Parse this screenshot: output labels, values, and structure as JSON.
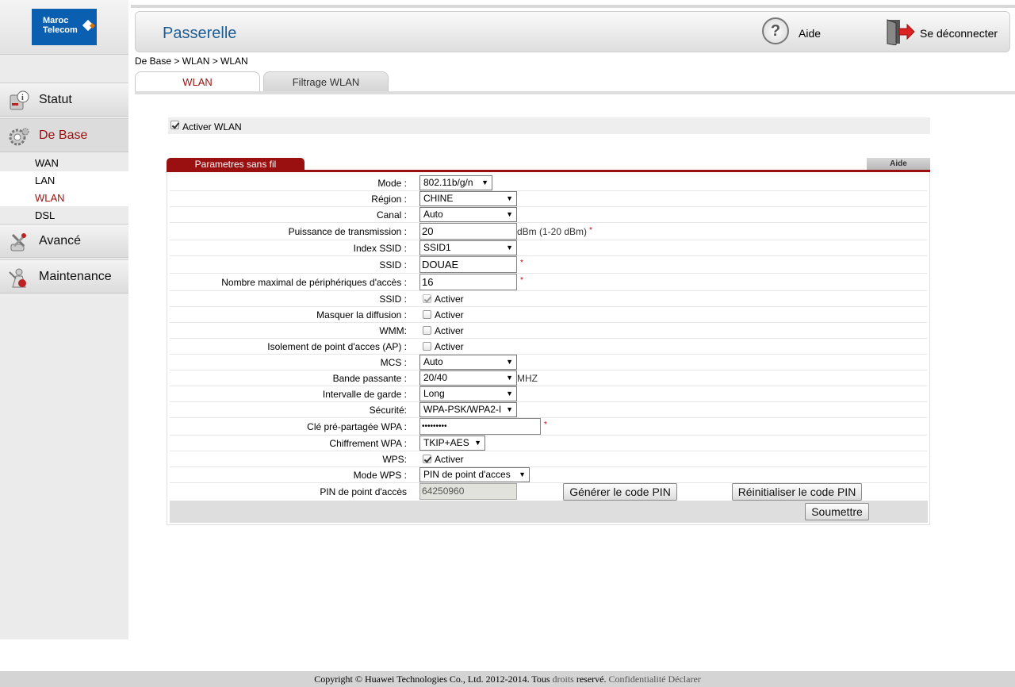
{
  "brand": {
    "logo_line1": "Maroc",
    "logo_line2": "Telecom"
  },
  "header": {
    "title": "Passerelle",
    "help_label": "Aide",
    "logout_label": "Se déconnecter"
  },
  "sidebar": {
    "items": [
      {
        "label": "Statut",
        "icon": "status-info-icon"
      },
      {
        "label": "De Base",
        "icon": "gear-icon",
        "active": true
      },
      {
        "label": "Avancé",
        "icon": "tools-icon"
      },
      {
        "label": "Maintenance",
        "icon": "maintenance-person-icon"
      }
    ],
    "sub_items": [
      "WAN",
      "LAN",
      "WLAN",
      "DSL"
    ],
    "active_sub": "WLAN"
  },
  "breadcrumb": "De Base > WLAN > WLAN",
  "tabs": [
    "WLAN",
    "Filtrage WLAN"
  ],
  "enable_wlan": {
    "label": "Activer WLAN",
    "checked": true
  },
  "section": {
    "title": "Parametres sans fil",
    "help": "Aide"
  },
  "form": {
    "mode": {
      "label": "Mode :",
      "value": "802.11b/g/n"
    },
    "region": {
      "label": "Région :",
      "value": "CHINE"
    },
    "channel": {
      "label": "Canal :",
      "value": "Auto"
    },
    "tx_power": {
      "label": "Puissance de transmission :",
      "value": "20",
      "unit": "dBm (1-20 dBm)",
      "required": "*"
    },
    "ssid_index": {
      "label": "Index SSID :",
      "value": "SSID1"
    },
    "ssid": {
      "label": "SSID :",
      "value": "DOUAE",
      "required": "*"
    },
    "max_devices": {
      "label": "Nombre maximal de périphériques d'accès :",
      "value": "16",
      "required": "*"
    },
    "ssid_enable": {
      "label": "SSID :",
      "text": "Activer",
      "checked": true,
      "disabled": true
    },
    "hide_broadcast": {
      "label": "Masquer la diffusion :",
      "text": "Activer",
      "checked": false
    },
    "wmm": {
      "label": "WMM:",
      "text": "Activer",
      "checked": false
    },
    "ap_isolation": {
      "label": "Isolement de point d'acces (AP) :",
      "text": "Activer",
      "checked": false
    },
    "mcs": {
      "label": "MCS :",
      "value": "Auto"
    },
    "bandwidth": {
      "label": "Bande passante :",
      "value": "20/40",
      "unit": "MHZ"
    },
    "guard_interval": {
      "label": "Intervalle de garde :",
      "value": "Long"
    },
    "security": {
      "label": "Sécurité:",
      "value": "WPA-PSK/WPA2-I"
    },
    "wpa_key": {
      "label": "Clé pré-partagée WPA :",
      "value": "•••••••••",
      "required": "*"
    },
    "wpa_encryption": {
      "label": "Chiffrement WPA :",
      "value": "TKIP+AES"
    },
    "wps": {
      "label": "WPS:",
      "text": "Activer",
      "checked": true
    },
    "wps_mode": {
      "label": "Mode WPS :",
      "value": "PIN de point d'acces"
    },
    "ap_pin": {
      "label": "PIN de point d'accès",
      "value": "64250960"
    },
    "generate_pin": "Générer le code PIN",
    "reset_pin": "Réinitialiser le code PIN",
    "submit": "Soumettre"
  },
  "footer": {
    "copyright": "Copyright © Huawei Technologies Co., Ltd. 2012-2014. Tous",
    "rights": "droits",
    "reserved": "reservé.",
    "privacy": "Confidentialité Déclarer"
  }
}
